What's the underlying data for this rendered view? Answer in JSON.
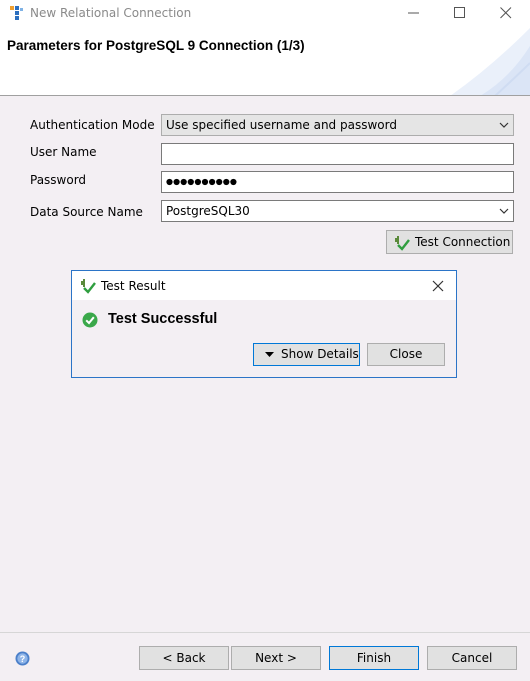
{
  "window": {
    "title": "New Relational Connection"
  },
  "banner": {
    "title": "Parameters for PostgreSQL 9 Connection (1/3)"
  },
  "form": {
    "auth_mode": {
      "label": "Authentication Mode",
      "value": "Use specified username and password"
    },
    "user_name": {
      "label": "User Name",
      "value": ""
    },
    "password": {
      "label": "Password",
      "masked_length": 10
    },
    "data_source": {
      "label": "Data Source Name",
      "value": "PostgreSQL30"
    }
  },
  "test_connection_label": "Test Connection",
  "dialog": {
    "title": "Test Result",
    "message": "Test Successful",
    "show_details_label": "Show Details",
    "close_label": "Close"
  },
  "footer": {
    "back_label": "< Back",
    "next_label": "Next >",
    "finish_label": "Finish",
    "cancel_label": "Cancel"
  },
  "icons": {
    "app": "app-logo-icon",
    "test": "connection-check-icon",
    "success": "success-check-icon",
    "help": "help-icon"
  },
  "colors": {
    "accent": "#0078d7",
    "dialog_border": "#2b74c7",
    "success": "#3aa84a",
    "background": "#f3eff3"
  }
}
